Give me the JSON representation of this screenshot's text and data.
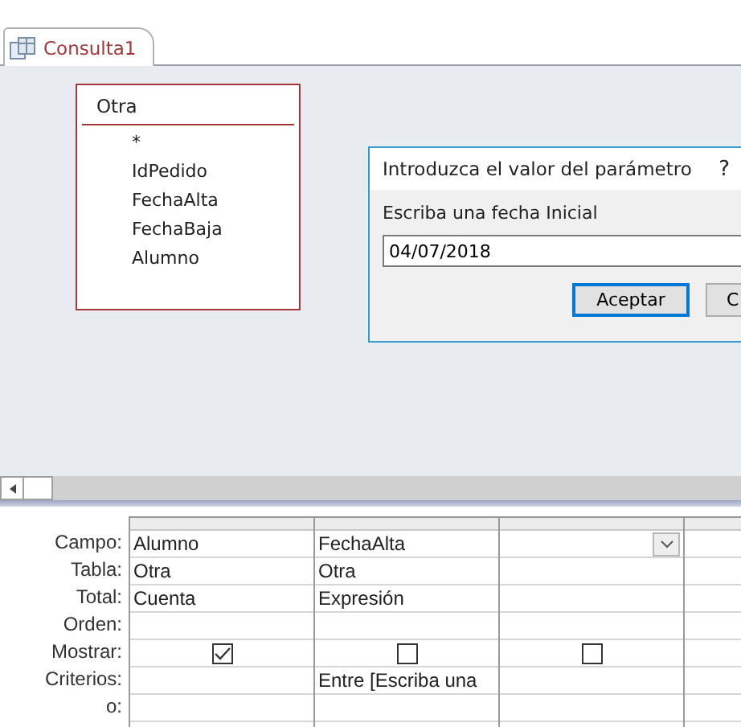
{
  "tabs": [
    {
      "label": "Consulta1",
      "selected": true
    }
  ],
  "table": {
    "title": "Otra",
    "fields": [
      "*",
      "IdPedido",
      "FechaAlta",
      "FechaBaja",
      "Alumno"
    ]
  },
  "dialog": {
    "title": "Introduzca el valor del parámetro",
    "help": "?",
    "prompt": "Escriba una fecha Inicial",
    "value": "04/07/2018",
    "buttons": [
      {
        "label": "Aceptar",
        "selected": true
      },
      {
        "label": "C",
        "selected": false
      }
    ]
  },
  "grid": {
    "row_labels": [
      "Campo:",
      "Tabla:",
      "Total:",
      "Orden:",
      "Mostrar:",
      "Criterios:",
      "o:"
    ],
    "columns": [
      {
        "campo": "Alumno",
        "tabla": "Otra",
        "total": "Cuenta",
        "mostrar": true,
        "dropdown": false
      },
      {
        "campo": "FechaAlta",
        "tabla": "Otra",
        "total": "Expresión",
        "mostrar": false,
        "criterios": "Entre [Escriba una",
        "dropdown": false
      },
      {
        "mostrar": false,
        "dropdown": true
      }
    ]
  }
}
